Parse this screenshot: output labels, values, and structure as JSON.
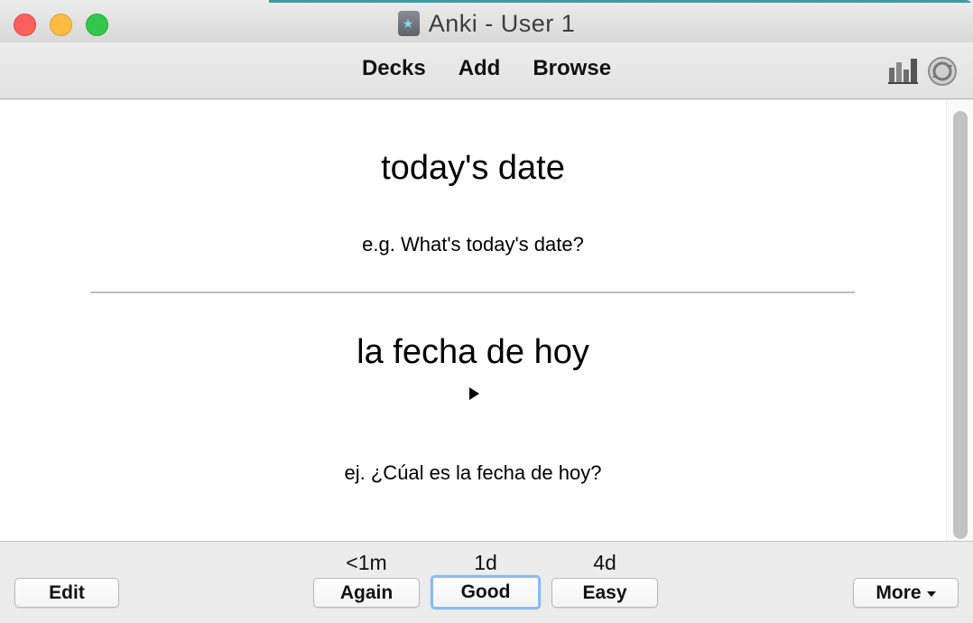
{
  "window": {
    "title": "Anki - User 1"
  },
  "toolbar": {
    "decks_label": "Decks",
    "add_label": "Add",
    "browse_label": "Browse",
    "icons": [
      "stats-icon",
      "sync-icon"
    ]
  },
  "card": {
    "front": "today's date",
    "front_example": "e.g. What's today's date?",
    "back": "la fecha de hoy",
    "back_example": "ej. ¿Cúal es la fecha de hoy?"
  },
  "answer_bar": {
    "edit_label": "Edit",
    "more_label": "More",
    "buttons": [
      {
        "label": "Again",
        "interval": "<1m"
      },
      {
        "label": "Good",
        "interval": "1d"
      },
      {
        "label": "Easy",
        "interval": "4d"
      }
    ]
  },
  "colors": {
    "close": "#fc605c",
    "minimize": "#fdbc40",
    "zoom": "#34c84a",
    "focus_ring": "#8cbcf0"
  }
}
